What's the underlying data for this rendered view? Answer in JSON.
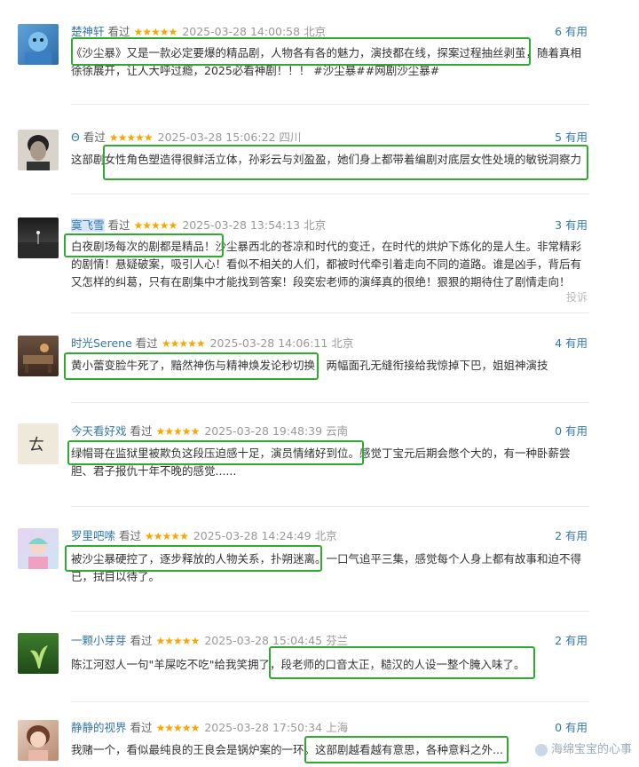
{
  "reviews": [
    {
      "user": "楚神轩",
      "watched": "看过",
      "stars": "★★★★★",
      "time": "2025-03-28 14:00:58",
      "location": "北京",
      "useful": "6 有用",
      "content": "《沙尘暴》又是一款必定要爆的精品剧，人物各有各的魅力，演技都在线，探案过程抽丝剥茧，随着真相徐徐展开，让人大呼过瘾，2025必看神剧！！！ #沙尘暴##网剧沙尘暴#"
    },
    {
      "user": "Θ",
      "watched": "看过",
      "stars": "★★★★★",
      "time": "2025-03-28 15:06:22",
      "location": "四川",
      "useful": "5 有用",
      "content": "这部剧女性角色塑造得很鲜活立体，孙彩云与刘盈盈，她们身上都带着编剧对底层女性处境的敏锐洞察力"
    },
    {
      "user": "寞飞雪",
      "watched": "看过",
      "stars": "★★★★★",
      "time": "2025-03-28 13:54:13",
      "location": "北京",
      "useful": "3 有用",
      "content": "白夜剧场每次的剧都是精品！沙尘暴西北的苍凉和时代的变迁，在时代的烘炉下炼化的是人生。非常精彩的剧情！悬疑破案，吸引人心！看似不相关的人们，都被时代牵引着走向不同的道路。谁是凶手，背后有又怎样的纠葛，只有在剧集中才能找到答案！段奕宏老师的演绎真的很绝！狠狠的期待住了剧情走向！",
      "report": "投诉"
    },
    {
      "user": "时光Serene",
      "watched": "看过",
      "stars": "★★★★★",
      "time": "2025-03-28 14:06:11",
      "location": "北京",
      "useful": "4 有用",
      "content": "黄小蕾变脸牛死了，黯然神伤与精神焕发论秒切换，两幅面孔无缝衔接给我惊掉下巴，姐姐神演技"
    },
    {
      "user": "今天看好戏",
      "watched": "看过",
      "stars": "★★★★★",
      "time": "2025-03-28 19:48:39",
      "location": "云南",
      "useful": "0 有用",
      "content": "绿帽哥在监狱里被欺负这段压迫感十足，演员情绪好到位。感觉丁宝元后期会憋个大的，有一种卧薪尝胆、君子报仇十年不晚的感觉......"
    },
    {
      "user": "罗里吧嗦",
      "watched": "看过",
      "stars": "★★★★★",
      "time": "2025-03-28 14:24:49",
      "location": "北京",
      "useful": "2 有用",
      "content": "被沙尘暴硬控了，逐步释放的人物关系，扑朔迷离。一口气追平三集，感觉每个人身上都有故事和迫不得已，拭目以待了。"
    },
    {
      "user": "一颗小芽芽",
      "watched": "看过",
      "stars": "★★★★★",
      "time": "2025-03-28 15:04:45",
      "location": "芬兰",
      "useful": "2 有用",
      "content": "陈江河怼人一句\"羊屎吃不吃\"给我笑拥了，段老师的口音太正，糙汉的人设一整个腌入味了。"
    },
    {
      "user": "静静的视界",
      "watched": "看过",
      "stars": "★★★★★",
      "time": "2025-03-28 17:50:34",
      "location": "上海",
      "useful": "0 有用",
      "content": "我赌一个，看似最纯良的王良会是锅炉案的一环。这部剧越看越有意思，各种意料之外..."
    }
  ],
  "watermark": "海绵宝宝的心事",
  "colors": {
    "highlight": "#2eaa2e",
    "user": "#3377aa",
    "stars": "#f6a700"
  }
}
